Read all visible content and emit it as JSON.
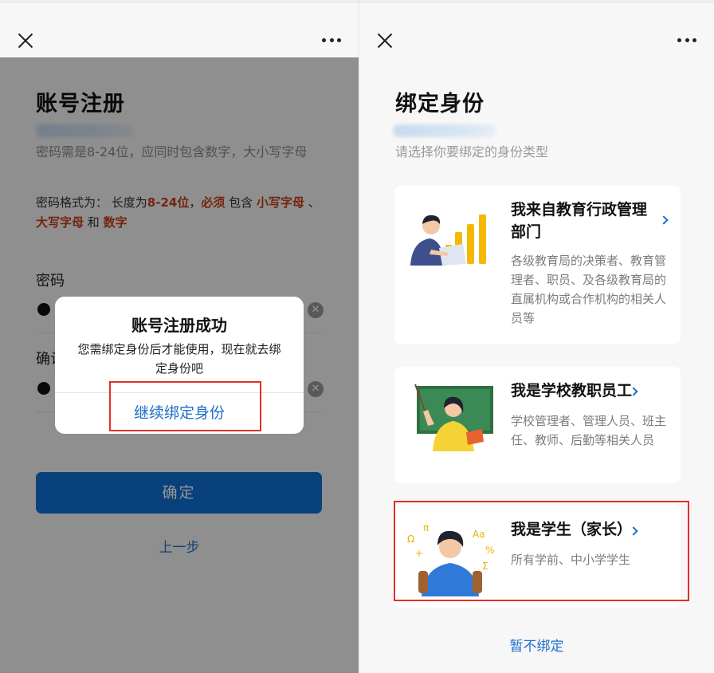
{
  "left": {
    "title": "账号注册",
    "pwd_hint": "密码需是8-24位，应同时包含数字，大小写字母",
    "rule": {
      "prefix": "密码格式为：  长度为",
      "len": "8-24位",
      "comma": "，",
      "must": "必须",
      "contains": " 包含 ",
      "lower": "小写字母",
      "sep": " 、 ",
      "upper": "大写字母",
      "and": " 和 ",
      "digit": "数字"
    },
    "password_label": "密码",
    "confirm_label": "确认密码",
    "clear_glyph": "✕",
    "confirm_button": "确定",
    "prev_link": "上一步"
  },
  "dialog": {
    "title": "账号注册成功",
    "message": "您需绑定身份后才能使用，现在就去绑定身份吧",
    "action": "继续绑定身份"
  },
  "right": {
    "title": "绑定身份",
    "subtitle": "请选择你要绑定的身份类型",
    "cards": [
      {
        "title": "我来自教育行政管理部门",
        "desc": "各级教育局的决策者、教育管理者、职员、及各级教育局的直属机构或合作机构的相关人员等"
      },
      {
        "title": "我是学校教职员工",
        "desc": "学校管理者、管理人员、班主任、教师、后勤等相关人员"
      },
      {
        "title": "我是学生（家长）",
        "desc": "所有学前、中小学学生"
      }
    ],
    "skip_link": "暂不绑定"
  },
  "colors": {
    "accent": "#1170d6",
    "link": "#1b6fc9",
    "highlight_box": "#e0302a",
    "rule_emphasis": "#c7401a"
  },
  "icons": [
    "close-icon",
    "more-icon",
    "chevron-right-icon",
    "clear-icon"
  ]
}
